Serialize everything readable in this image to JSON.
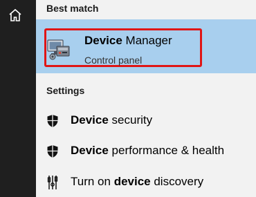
{
  "sidebar": {
    "home_icon": "home-icon"
  },
  "best_match": {
    "heading": "Best match",
    "app": {
      "name_bold": "Device",
      "name_rest": " Manager",
      "subtitle": "Control panel",
      "icon": "device-manager-icon"
    }
  },
  "settings": {
    "heading": "Settings",
    "items": [
      {
        "icon": "shield-icon",
        "pre": "",
        "bold": "Device",
        "post": " security"
      },
      {
        "icon": "shield-icon",
        "pre": "",
        "bold": "Device",
        "post": " performance & health"
      },
      {
        "icon": "discovery-icon",
        "pre": "Turn on ",
        "bold": "device",
        "post": " discovery"
      }
    ]
  },
  "colors": {
    "sidebar_bg": "#1f1f1f",
    "panel_bg": "#f2f2f2",
    "selected_bg": "#a8cfee",
    "highlight_border": "#e01515"
  }
}
